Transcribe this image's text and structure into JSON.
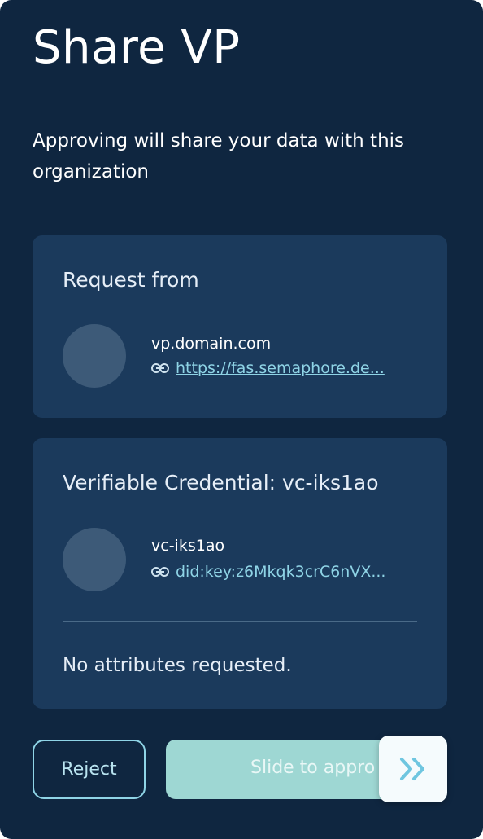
{
  "page": {
    "title": "Share VP",
    "subtitle": "Approving will share your data with this organization"
  },
  "request_card": {
    "heading": "Request from",
    "entity_name": "vp.domain.com",
    "entity_link": "https://fas.semaphore.de..."
  },
  "credential_card": {
    "heading": "Verifiable Credential: vc-iks1ao",
    "entity_name": "vc-iks1ao",
    "entity_link": "did:key:z6Mkqk3crC6nVX...",
    "note": "No attributes requested."
  },
  "actions": {
    "reject_label": "Reject",
    "approve_slider_label": "Slide to appro"
  },
  "icons": {
    "link": "link-icon",
    "slider": "double-chevron-right-icon"
  },
  "colors": {
    "background": "#0f2640",
    "card": "#1b3a5c",
    "accent": "#8fd4e6",
    "slider": "#9ed7d3"
  }
}
